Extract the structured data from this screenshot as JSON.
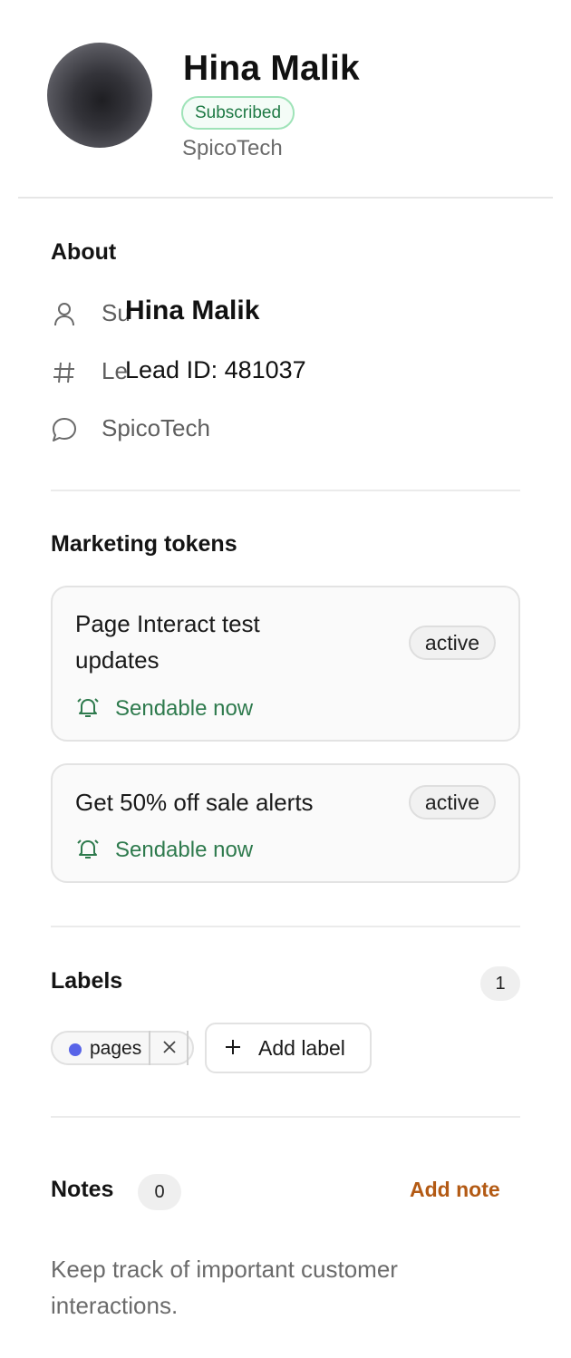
{
  "profile": {
    "name": "Hina Malik",
    "status_badge": "Subscribed",
    "company": "SpicoTech"
  },
  "about": {
    "title": "About",
    "rows": [
      {
        "icon": "person-icon",
        "text": "Su",
        "overlay": "Hina Malik"
      },
      {
        "icon": "hash-icon",
        "text": "Le",
        "overlay": "Lead ID: 481037"
      },
      {
        "icon": "chat-bubble-icon",
        "text": "SpicoTech"
      }
    ]
  },
  "marketing": {
    "title": "Marketing tokens",
    "tokens": [
      {
        "title_line1": "Page Interact test",
        "title_line2": "updates",
        "status": "active",
        "availability": "Sendable now",
        "icon": "bell-icon"
      },
      {
        "title_line1": "Get 50% off sale alerts",
        "status": "active",
        "availability": "Sendable now",
        "icon": "bell-icon"
      }
    ]
  },
  "labels": {
    "title": "Labels",
    "count": "1",
    "items": [
      {
        "name": "pages",
        "color": "#5864e8"
      }
    ],
    "add_label": "Add label"
  },
  "notes": {
    "title": "Notes",
    "count": "0",
    "add_note": "Add note",
    "empty_text": "Keep track of important customer interactions."
  },
  "colors": {
    "accent_orange": "#b35a14",
    "success_green": "#2e7a4d",
    "badge_border": "#9fe3b8"
  }
}
